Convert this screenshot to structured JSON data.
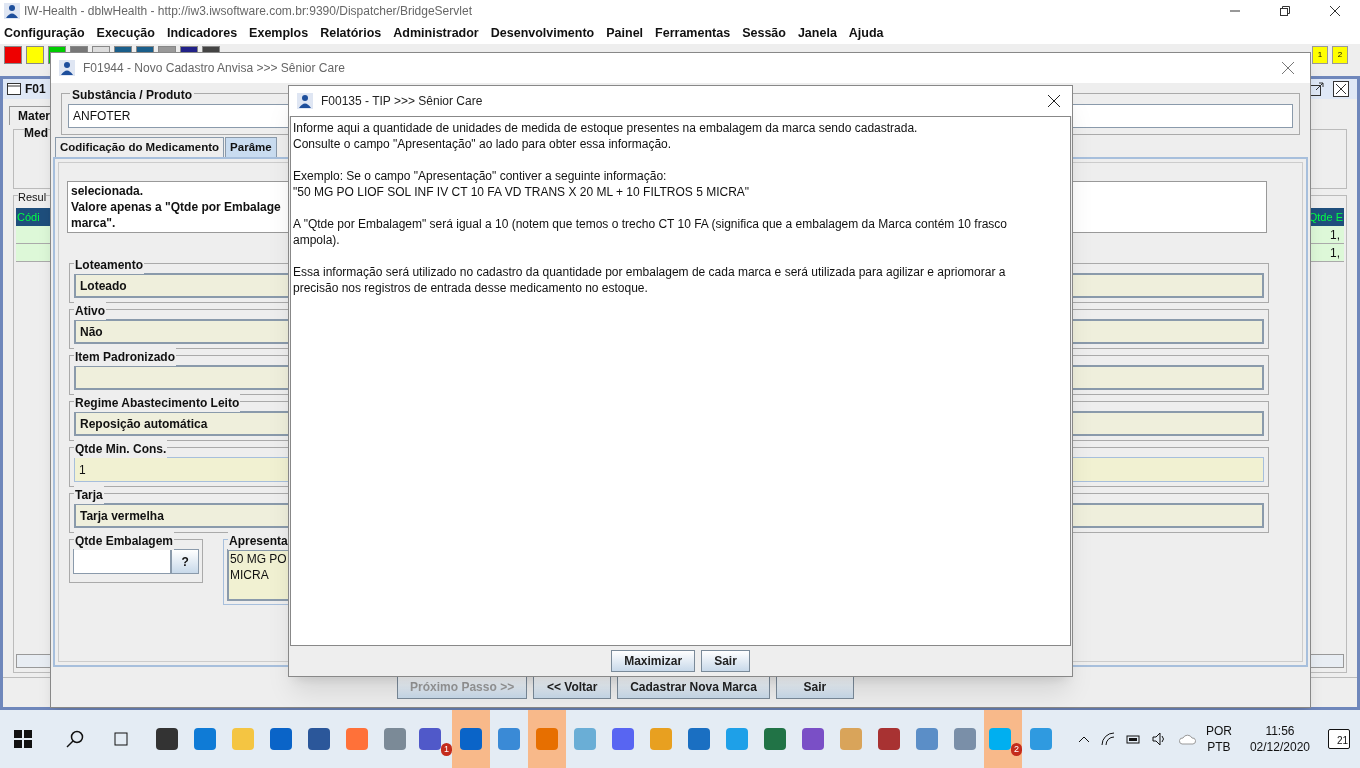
{
  "window": {
    "title": "IW-Health - dblwHealth - http://iw3.iwsoftware.com.br:9390/Dispatcher/BridgeServlet"
  },
  "menu": [
    "Configuração",
    "Execução",
    "Indicadores",
    "Exemplos",
    "Relatórios",
    "Administrador",
    "Desenvolvimento",
    "Painel",
    "Ferramentas",
    "Sessão",
    "Janela",
    "Ajuda"
  ],
  "toolbar_badges": [
    "1",
    "2"
  ],
  "background_frame": {
    "title": "F01",
    "tab": "Mater",
    "group": "Med",
    "results_label": "Resul",
    "columns": [
      "Códi",
      "Qtde E"
    ],
    "rows": [
      {
        "column_2": "1,"
      },
      {
        "column_2": "1,"
      }
    ]
  },
  "register_dialog": {
    "title": "F01944 - Novo Cadastro Anvisa >>> Sênior Care",
    "substance": {
      "label": "Substância / Produto",
      "value": "ANFOTER"
    },
    "tabs": [
      {
        "label": "Codificação do Medicamento",
        "selected": false
      },
      {
        "label": "Parâme",
        "selected": true
      }
    ],
    "info_lines": [
      "selecionada.",
      "Valore apenas a \"Qtde por Embalage",
      "marca\"."
    ],
    "fields": [
      {
        "label": "Loteamento",
        "kind": "combo",
        "value": "Loteado"
      },
      {
        "label": "Ativo",
        "kind": "combo",
        "value": "Não"
      },
      {
        "label": "Item Padronizado",
        "kind": "combo"
      },
      {
        "label": "Regime Abastecimento Leito",
        "kind": "combo",
        "value": "Reposição automática"
      },
      {
        "label": "Qtde Min. Cons.",
        "kind": "text",
        "value": "1"
      },
      {
        "label": "Tarja",
        "kind": "combo",
        "value": "Tarja vermelha"
      }
    ],
    "package_qty": {
      "label": "Qtde Embalagem",
      "help_button": "?"
    },
    "presentation": {
      "label": "Apresenta",
      "lines": [
        "50 MG PO",
        "MICRA"
      ]
    },
    "buttons": [
      {
        "label": "Próximo Passo >>",
        "disabled": true
      },
      {
        "label": "<< Voltar",
        "disabled": false
      },
      {
        "label": "Cadastrar Nova Marca",
        "disabled": false
      },
      {
        "label": "Sair",
        "disabled": false
      }
    ]
  },
  "tip_dialog": {
    "title": "F00135 - TIP >>> Sênior Care",
    "paragraphs": [
      [
        "Informe aqui a quantidade de unidades de medida de estoque presentes na embalagem da marca sendo cadastrada.",
        "Consulte o campo \"Apresentação\" ao lado para obter essa informação."
      ],
      [
        "Exemplo: Se o campo \"Apresentação\" contiver a seguinte informação:",
        "\"50 MG PO LIOF SOL INF IV CT 10 FA VD TRANS X 20 ML + 10 FILTROS 5 MICRA\""
      ],
      [
        "A \"Qtde por Embalagem\" será igual a 10 (notem que temos o trecho CT 10 FA (significa que a embalagem da Marca contém 10 frasco",
        "ampola)."
      ],
      [
        "Essa informação será utilizado no cadastro da quantidade por embalagem de cada marca e será utilizada para agilizar e apriomorar a",
        "precisão nos registros de entrada desse medicamento no estoque."
      ]
    ],
    "buttons": [
      "Maximizar",
      "Sair"
    ]
  },
  "taskbar": {
    "badges": [
      "1",
      "2"
    ],
    "language": "POR",
    "layout": "PTB",
    "time": "11:56",
    "date": "02/12/2020",
    "notifications": "21"
  }
}
